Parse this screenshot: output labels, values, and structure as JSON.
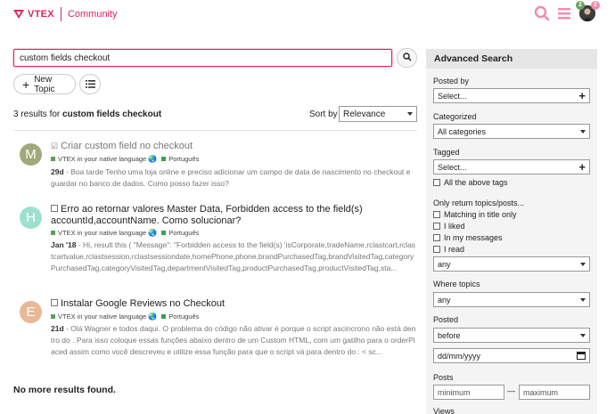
{
  "header": {
    "brand": "VTEX",
    "community": "Community",
    "badge_left": "2",
    "badge_right": "2",
    "accent": "#e0245e"
  },
  "search": {
    "query": "custom fields checkout",
    "new_topic_label": "New Topic"
  },
  "results_bar": {
    "count_text": "3 results for",
    "query_bold": "custom fields checkout",
    "sort_label": "Sort by",
    "sort_value": "Relevance"
  },
  "results": [
    {
      "avatar_letter": "M",
      "avatar_color": "#a3a87c",
      "title": "Criar custom field no checkout",
      "category": "VTEX in your native language",
      "category_color": "#5aa05a",
      "tag": "Português",
      "tag_color": "#3aa24b",
      "age": "29d",
      "excerpt": " - Boa tarde Tenho uma loja online e preciso adicionar um campo de data de nascimento no checkout e guardar no banco de dados. Como posso fazer isso?"
    },
    {
      "avatar_letter": "H",
      "avatar_color": "#9ee0cf",
      "title": "Erro ao retornar valores Master Data, Forbidden access to the field(s) accountId,accountName. Como solucionar?",
      "category": "VTEX in your native language",
      "category_color": "#5aa05a",
      "tag": "Português",
      "tag_color": "#3aa24b",
      "age": "Jan '18",
      "excerpt": " - Hi, result this ( \"Message\": \"Forbidden access to the field(s) 'isCorporate,tradeName,rclastcart,rclastcartvalue,rclastsession,rclastsessiondate,homePhone,phone,brandPurchasedTag,brandVisitedTag,categoryPurchasedTag,categoryVisitedTag,departmentVisitedTag,productPurchasedTag,productVisitedTag,sta..."
    },
    {
      "avatar_letter": "E",
      "avatar_color": "#e8b898",
      "title": "Instalar Google Reviews no Checkout",
      "category": "VTEX in your native language",
      "category_color": "#5aa05a",
      "tag": "Português",
      "tag_color": "#3aa24b",
      "age": "21d",
      "excerpt": " - Olá Wagner e todos daqui. O problema do código não ativar é porque o script ascincrono não está dentro do . Para isso coloque essas funções abaixo dentro de um Custom HTML, com um gatilho para o orderPlaced assim como você descreveu e utilize essa função para que o script vá para dentro do : < sc..."
    }
  ],
  "no_more": "No more results found.",
  "advanced": {
    "title": "Advanced Search",
    "posted_by_label": "Posted by",
    "posted_by_value": "Select...",
    "categorized_label": "Categorized",
    "categorized_value": "All categories",
    "tagged_label": "Tagged",
    "tagged_value": "Select...",
    "all_tags_label": "All the above tags",
    "only_return_label": "Only return topics/posts...",
    "checks": [
      "Matching in title only",
      "I liked",
      "In my messages",
      "I read"
    ],
    "only_return_value": "any",
    "where_label": "Where topics",
    "where_value": "any",
    "posted_label": "Posted",
    "posted_value": "before",
    "date_placeholder": "dd/mm/yyyy",
    "posts_label": "Posts",
    "posts_min": "minimum",
    "posts_max": "maximum",
    "views_label": "Views"
  }
}
